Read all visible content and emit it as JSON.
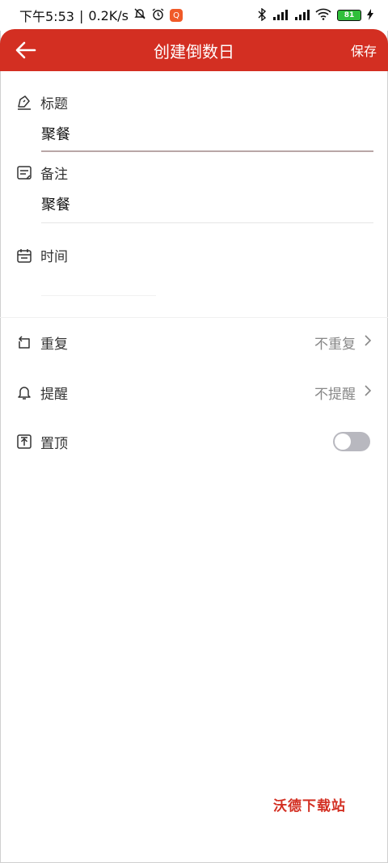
{
  "status_bar": {
    "time": "下午5:53",
    "speed": "0.2K/s",
    "battery": "81",
    "app_badge": "Q"
  },
  "header": {
    "title": "创建倒数日",
    "save_label": "保存"
  },
  "form": {
    "title_label": "标题",
    "title_value": "聚餐",
    "note_label": "备注",
    "note_value": "聚餐",
    "time_label": "时间",
    "time_value": ""
  },
  "options": {
    "repeat_label": "重复",
    "repeat_value": "不重复",
    "reminder_label": "提醒",
    "reminder_value": "不提醒",
    "pin_label": "置顶",
    "pin_on": false
  },
  "watermark": "沃德下载站",
  "colors": {
    "accent": "#d32f22",
    "toggle_off": "#b8b8bf"
  }
}
